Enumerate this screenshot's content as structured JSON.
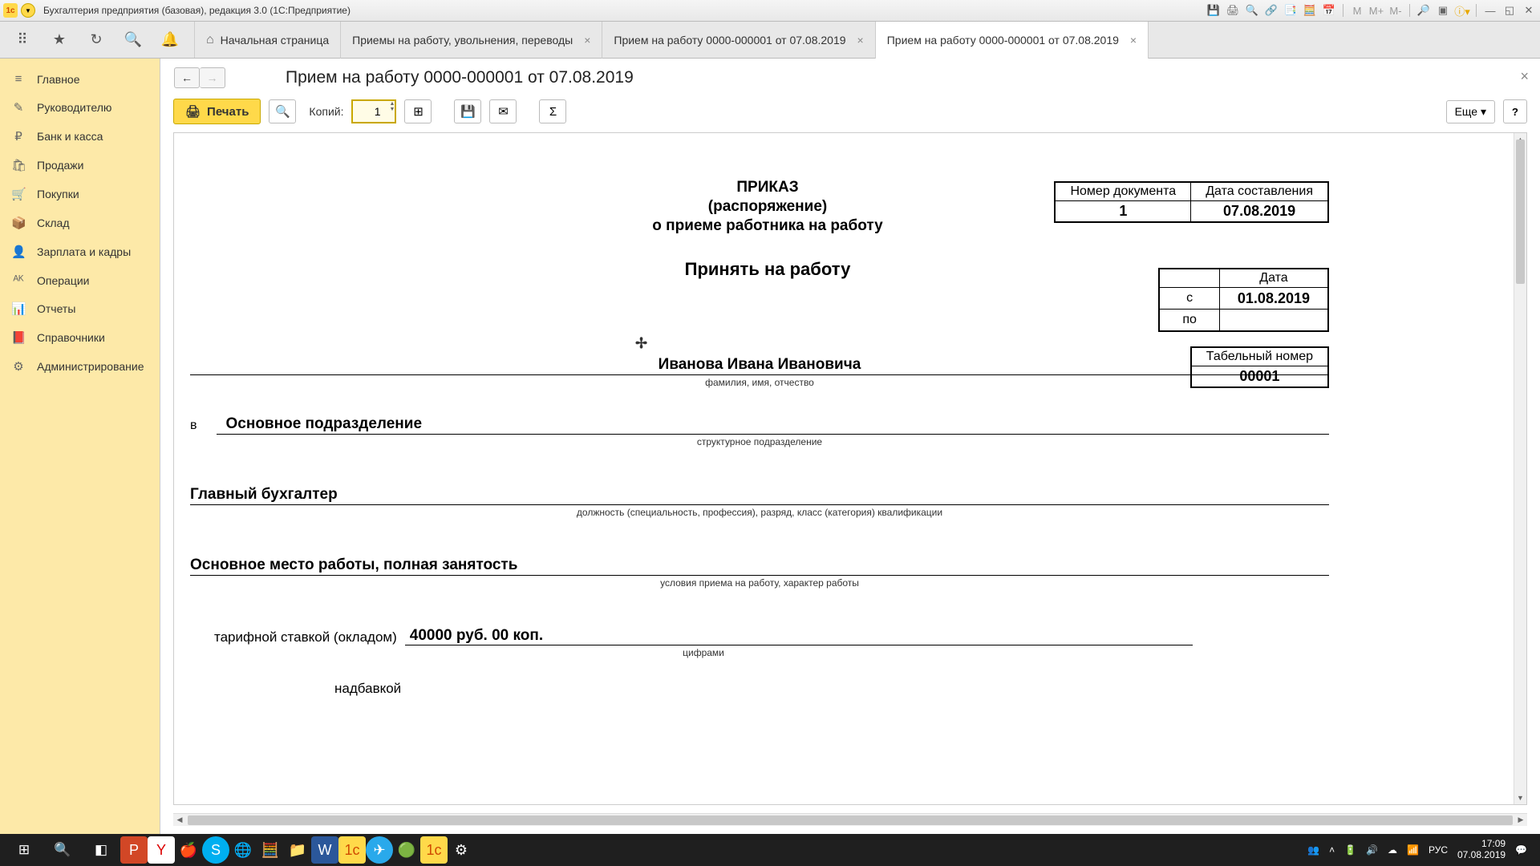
{
  "titlebar": {
    "app_title": "Бухгалтерия предприятия (базовая), редакция 3.0  (1С:Предприятие)"
  },
  "tabs": {
    "home": "Начальная страница",
    "t1": "Приемы на работу, увольнения, переводы",
    "t2": "Прием на работу 0000-000001 от 07.08.2019",
    "t3": "Прием на работу 0000-000001 от 07.08.2019"
  },
  "sidebar": {
    "items": [
      {
        "icon": "≡",
        "label": "Главное"
      },
      {
        "icon": "✎",
        "label": "Руководителю"
      },
      {
        "icon": "₽",
        "label": "Банк и касса"
      },
      {
        "icon": "🛍",
        "label": "Продажи"
      },
      {
        "icon": "🛒",
        "label": "Покупки"
      },
      {
        "icon": "📦",
        "label": "Склад"
      },
      {
        "icon": "👤",
        "label": "Зарплата и кадры"
      },
      {
        "icon": "ᴬᴷ",
        "label": "Операции"
      },
      {
        "icon": "📊",
        "label": "Отчеты"
      },
      {
        "icon": "📕",
        "label": "Справочники"
      },
      {
        "icon": "⚙",
        "label": "Администрирование"
      }
    ]
  },
  "page": {
    "title": "Прием на работу 0000-000001 от 07.08.2019",
    "print_btn": "Печать",
    "copies_label": "Копий:",
    "copies_value": "1",
    "more_btn": "Еще ▾",
    "help_btn": "?"
  },
  "doc": {
    "meta_hd_num": "Номер документа",
    "meta_hd_date": "Дата составления",
    "meta_num": "1",
    "meta_date": "07.08.2019",
    "title_l1": "ПРИКАЗ",
    "title_l2": "(распоряжение)",
    "title_l3": "о приеме работника на работу",
    "accept": "Принять на работу",
    "date_hd": "Дата",
    "date_from_lab": "с",
    "date_to_lab": "по",
    "date_from": "01.08.2019",
    "date_to": "",
    "tabnum_hd": "Табельный номер",
    "tabnum": "00001",
    "fio": "Иванова Ивана Ивановича",
    "fio_sub": "фамилия, имя, отчество",
    "in_prefix": "в",
    "dept": "Основное подразделение",
    "dept_sub": "структурное подразделение",
    "position": "Главный бухгалтер",
    "position_sub": "должность (специальность, профессия), разряд, класс (категория) квалификации",
    "conditions": "Основное место работы, полная занятость",
    "conditions_sub": "условия приема на работу, характер работы",
    "salary_pre": "тарифной ставкой (окладом)",
    "salary": "40000 руб. 00 коп.",
    "salary_sub": "цифрами",
    "bonus": "надбавкой"
  },
  "taskbar": {
    "lang": "РУС",
    "time": "17:09",
    "date": "07.08.2019"
  }
}
